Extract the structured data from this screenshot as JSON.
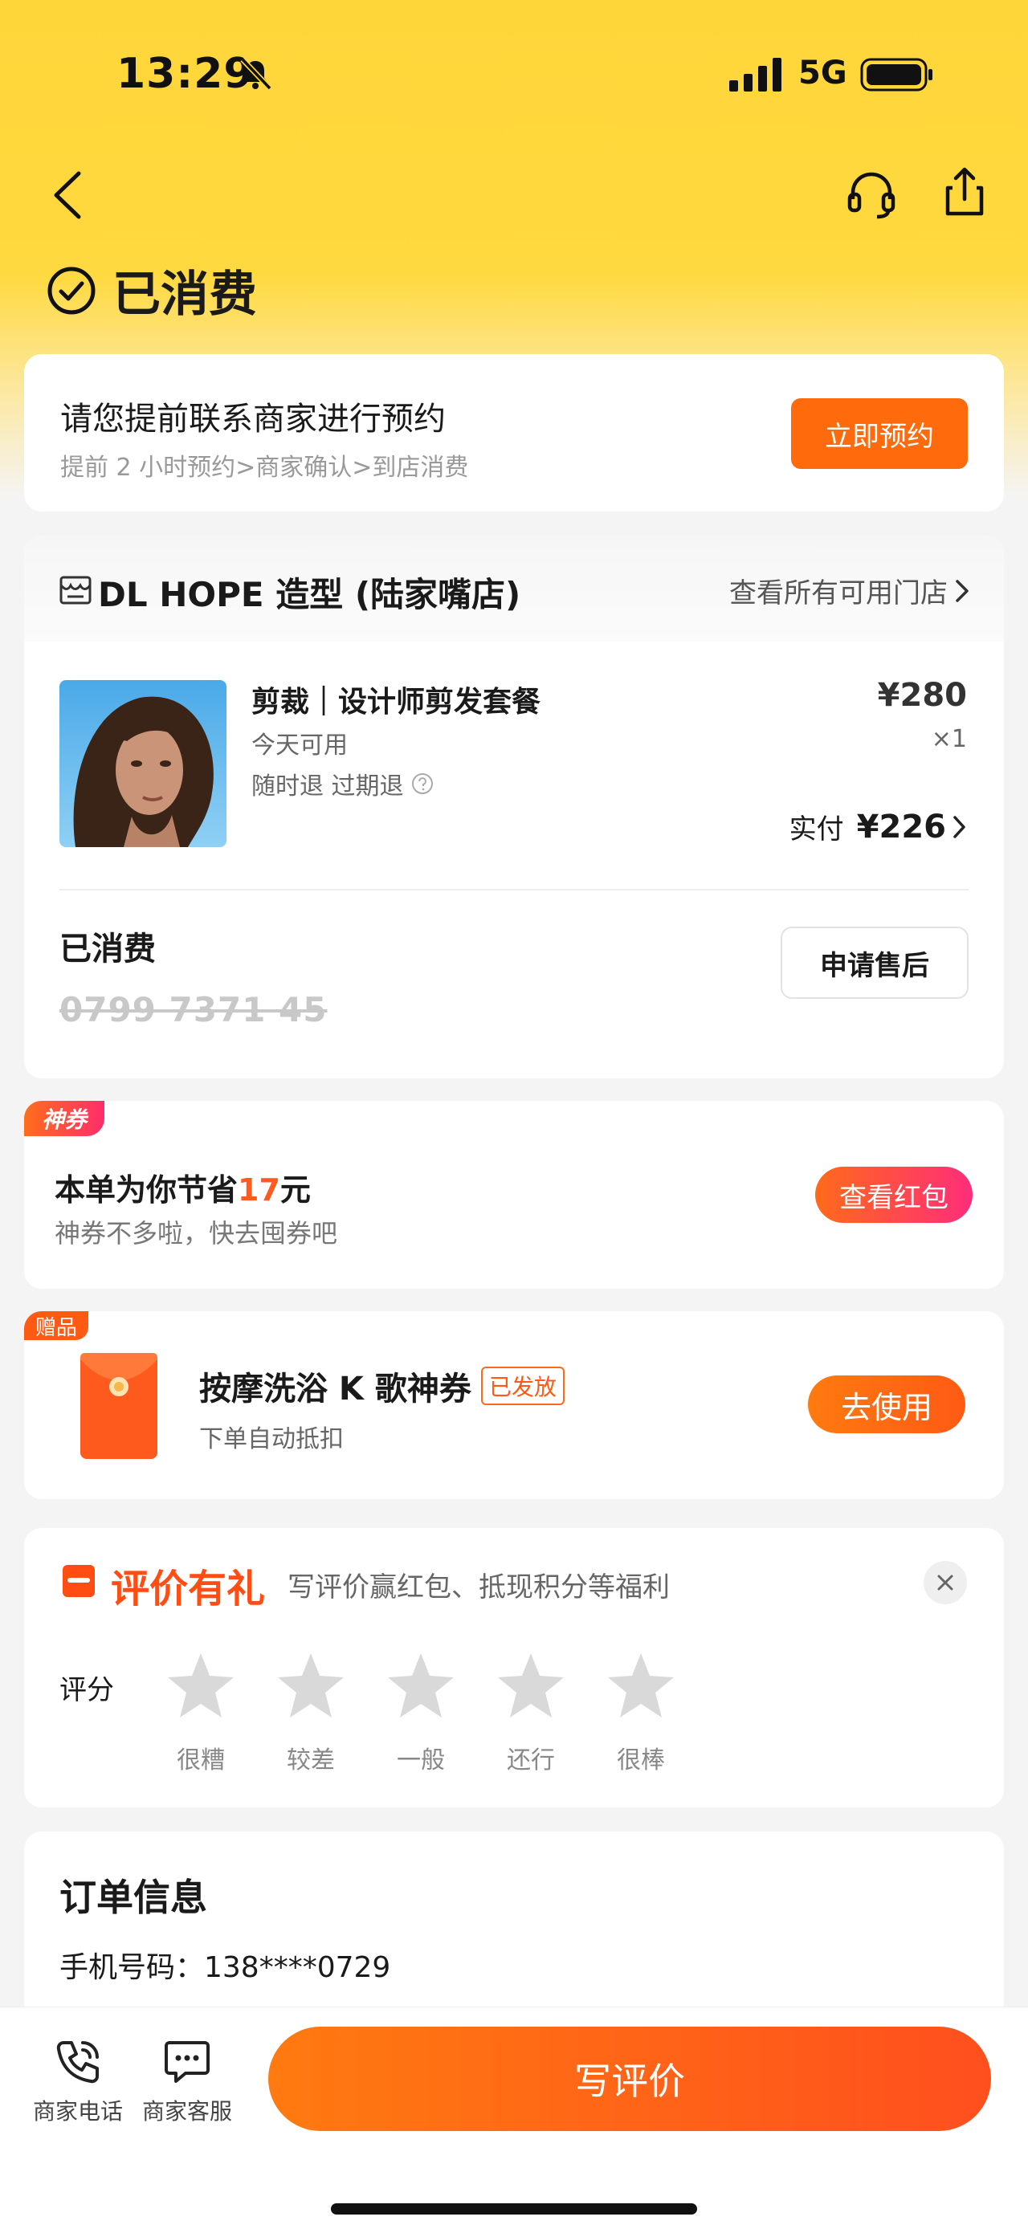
{
  "status_bar": {
    "time": "13:29",
    "network": "5G"
  },
  "page": {
    "status_title": "已消费"
  },
  "reserve": {
    "title": "请您提前联系商家进行预约",
    "subtitle": "提前 2 小时预约>商家确认>到店消费",
    "button": "立即预约"
  },
  "order": {
    "shop_name": "DL HOPE 造型 (陆家嘴店)",
    "all_stores": "查看所有可用门店",
    "product_name": "剪裁｜设计师剪发套餐",
    "available": "今天可用",
    "refund": "随时退 过期退",
    "price": "¥280",
    "quantity": "×1",
    "paid_label": "实付",
    "paid_value": "¥226",
    "consumed_label": "已消费",
    "voucher_code": "0799 7371 45",
    "aftersale_button": "申请售后"
  },
  "coupon": {
    "tag": "神券",
    "title_prefix": "本单为你节省",
    "saving": "17",
    "title_suffix": "元",
    "subtitle": "神券不多啦，快去囤券吧",
    "button": "查看红包"
  },
  "gift": {
    "tag": "赠品",
    "title": "按摩洗浴 K 歌神券",
    "badge": "已发放",
    "subtitle": "下单自动抵扣",
    "button": "去使用"
  },
  "review": {
    "title": "评价有礼",
    "subtitle": "写评价赢红包、抵现积分等福利",
    "rating_label": "评分",
    "stars": [
      "很糟",
      "较差",
      "一般",
      "还行",
      "很棒"
    ]
  },
  "info": {
    "title": "订单信息",
    "phone": "手机号码：138****0729"
  },
  "bottom": {
    "phone_label": "商家电话",
    "service_label": "商家客服",
    "write_review": "写评价"
  },
  "colors": {
    "brand_yellow": "#ffd63a",
    "accent_orange": "#ff6a0c",
    "highlight_orange": "#ff5a1f",
    "pink": "#ff2d7a"
  }
}
